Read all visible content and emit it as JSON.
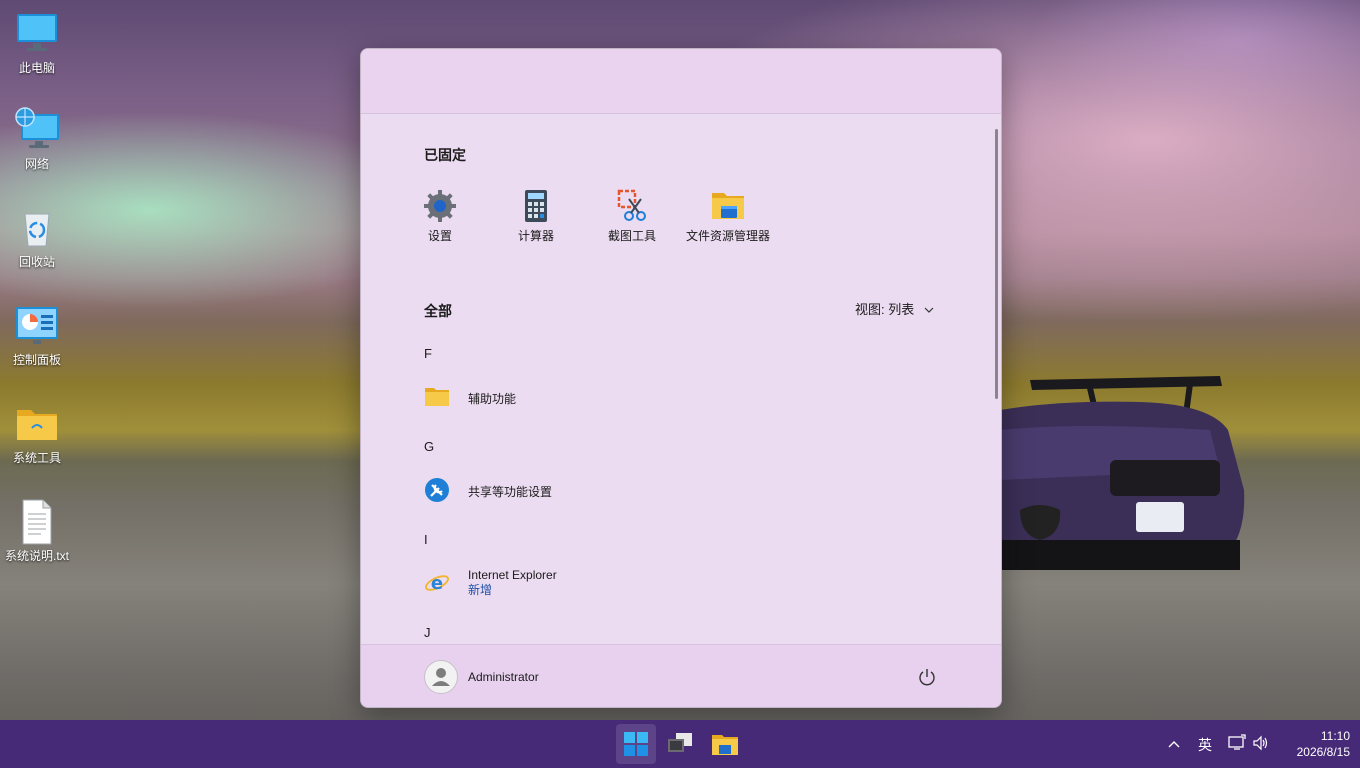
{
  "desktop": {
    "icons": [
      {
        "label": "此电脑",
        "icon": "this-pc-icon"
      },
      {
        "label": "网络",
        "icon": "network-icon"
      },
      {
        "label": "回收站",
        "icon": "recycle-bin-icon"
      },
      {
        "label": "控制面板",
        "icon": "control-panel-icon"
      },
      {
        "label": "系统工具",
        "icon": "folder-icon"
      },
      {
        "label": "系统说明.txt",
        "icon": "text-file-icon"
      }
    ]
  },
  "start_menu": {
    "search": {
      "value": "",
      "placeholder": ""
    },
    "pinned": {
      "title": "已固定",
      "items": [
        {
          "label": "设置",
          "icon": "gear-icon"
        },
        {
          "label": "计算器",
          "icon": "calculator-icon"
        },
        {
          "label": "截图工具",
          "icon": "snipping-tool-icon"
        },
        {
          "label": "文件资源管理器",
          "icon": "file-explorer-icon"
        }
      ]
    },
    "all": {
      "title": "全部",
      "view_label": "视图: 列表",
      "groups": [
        {
          "letter": "F",
          "apps": [
            {
              "label": "辅助功能",
              "icon": "folder-icon"
            }
          ]
        },
        {
          "letter": "G",
          "apps": [
            {
              "label": "共享等功能设置",
              "icon": "tools-icon"
            }
          ]
        },
        {
          "letter": "I",
          "apps": [
            {
              "label": "Internet Explorer",
              "sublabel": "新增",
              "icon": "internet-explorer-icon"
            }
          ]
        },
        {
          "letter": "J",
          "apps": []
        }
      ]
    },
    "footer": {
      "user_name": "Administrator"
    }
  },
  "taskbar": {
    "buttons": [
      {
        "name": "start",
        "icon": "windows-logo-icon",
        "active": true
      },
      {
        "name": "task-view",
        "icon": "task-view-icon",
        "active": false
      },
      {
        "name": "file-explorer",
        "icon": "file-explorer-icon",
        "active": false
      }
    ],
    "tray": {
      "input_method": "英",
      "time": "11:10",
      "date": "2026/8/15"
    }
  },
  "colors": {
    "taskbar": "#472a77",
    "start_menu_bg": "#ecdcf1",
    "folder_yellow": "#f5c23c",
    "accent_blue": "#1f7fd6"
  }
}
